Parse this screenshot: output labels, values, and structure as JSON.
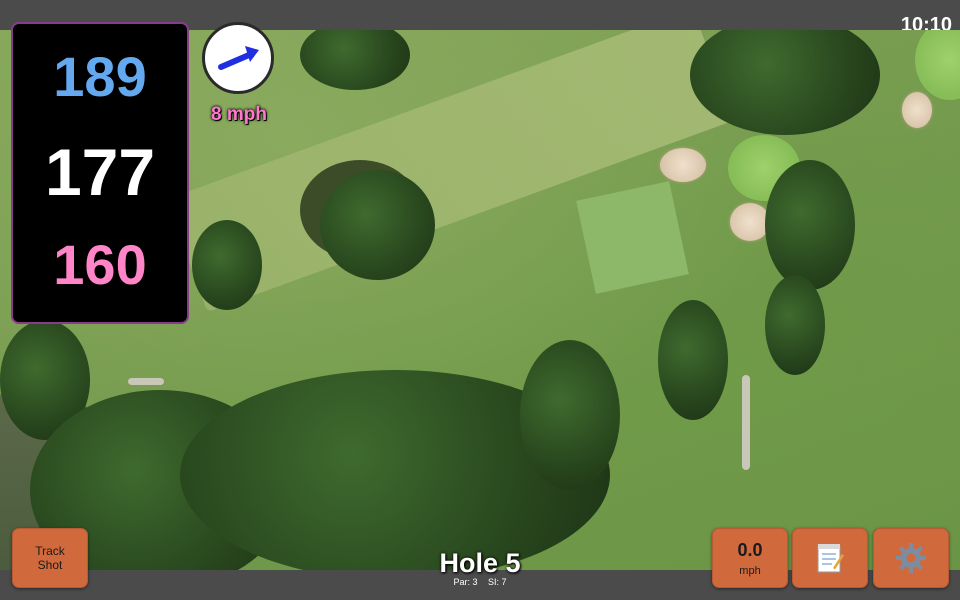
{
  "status": {
    "time": "10:10"
  },
  "distances": {
    "back": "189",
    "middle": "177",
    "front": "160"
  },
  "wind": {
    "speed": "8 mph",
    "arrow_color": "#1f2fe0"
  },
  "hole": {
    "title": "Hole 5",
    "par": "Par: 3",
    "stroke_index": "SI: 7"
  },
  "buttons": {
    "track_shot": "Track\nShot",
    "speed_value": "0.0",
    "speed_unit": "mph",
    "notes_icon": "notepad-icon",
    "settings_icon": "gear-icon"
  },
  "colors": {
    "back_distance": "#64a9f0",
    "middle_distance": "#ffffff",
    "front_distance": "#ff84c8",
    "button": "#d0693c",
    "panel_border": "#8a3a8a"
  }
}
